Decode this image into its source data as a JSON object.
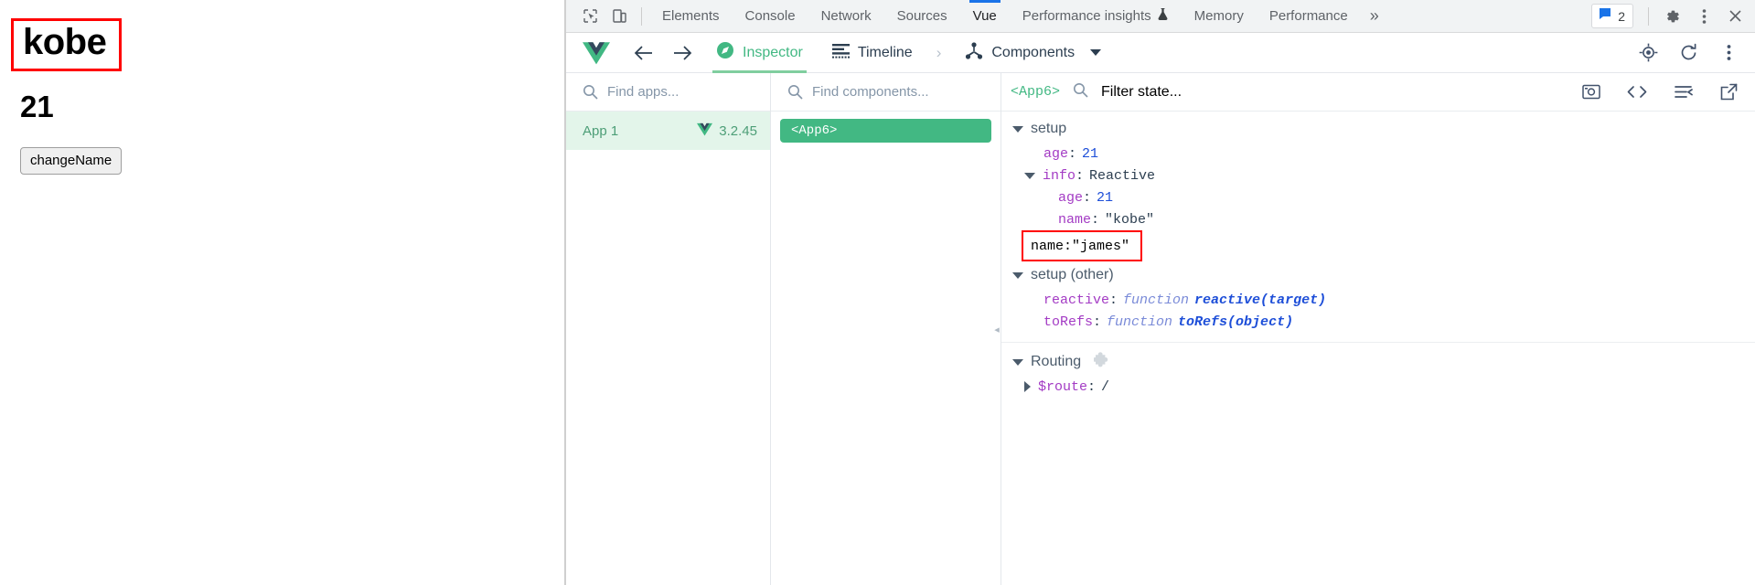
{
  "page": {
    "name": "kobe",
    "age": "21",
    "button_label": "changeName",
    "highlight_color": "#ff0000"
  },
  "devtools": {
    "tabs": [
      {
        "label": "Elements",
        "active": false
      },
      {
        "label": "Console",
        "active": false
      },
      {
        "label": "Network",
        "active": false
      },
      {
        "label": "Sources",
        "active": false
      },
      {
        "label": "Vue",
        "active": true
      },
      {
        "label": "Performance insights",
        "active": false,
        "icon": "beaker-icon"
      },
      {
        "label": "Memory",
        "active": false
      },
      {
        "label": "Performance",
        "active": false
      }
    ],
    "more_tabs_label": "»",
    "issues_count": "2",
    "icons": {
      "inspect": "inspect-element-icon",
      "device": "device-toolbar-icon",
      "issues": "issues-message-icon",
      "settings": "gear-icon",
      "more": "kebab-menu-icon",
      "close": "close-icon"
    },
    "accent": "#1a73e8"
  },
  "vue_toolbar": {
    "logo": "vue-logo-icon",
    "back": "back-arrow-icon",
    "forward": "forward-arrow-icon",
    "items": [
      {
        "label": "Inspector",
        "icon": "compass-icon",
        "active": true
      },
      {
        "label": "Timeline",
        "icon": "timeline-icon",
        "active": false
      },
      {
        "label": "Components",
        "icon": "components-tree-icon",
        "active": false,
        "has_dropdown": true
      }
    ],
    "separator": "›",
    "right_icons": [
      "target-icon",
      "refresh-icon",
      "kebab-menu-icon"
    ],
    "accent": "#42b883"
  },
  "apps_pane": {
    "search_placeholder": "Find apps...",
    "search_icon": "search-icon",
    "items": [
      {
        "name": "App 1",
        "version": "3.2.45",
        "icon": "vue-logo-icon",
        "selected": true
      }
    ]
  },
  "components_pane": {
    "search_placeholder": "Find components...",
    "search_icon": "search-icon",
    "items": [
      {
        "label": "<App6>",
        "selected": true
      }
    ],
    "collapse_handle": "◂"
  },
  "state_pane": {
    "component_tag": "<App6>",
    "filter_placeholder": "Filter state...",
    "filter_icon": "search-icon",
    "header_icons": [
      "screenshot-icon",
      "open-in-editor-code-icon",
      "collapse-all-icon",
      "open-external-icon"
    ],
    "groups": [
      {
        "name": "setup",
        "expanded": true,
        "rows": [
          {
            "indent": 1,
            "key": "age",
            "value": "21",
            "type": "number"
          },
          {
            "indent": 1,
            "key": "info",
            "value": "Reactive",
            "type": "plain",
            "expandable": true,
            "expanded": true
          },
          {
            "indent": 2,
            "key": "age",
            "value": "21",
            "type": "number"
          },
          {
            "indent": 2,
            "key": "name",
            "value": "\"kobe\"",
            "type": "string"
          },
          {
            "indent": 1,
            "key": "name",
            "value": "\"james\"",
            "type": "string",
            "highlighted": true
          }
        ]
      },
      {
        "name": "setup (other)",
        "expanded": true,
        "rows": [
          {
            "indent": 1,
            "key": "reactive",
            "fn_keyword": "function",
            "fn_name": "reactive(target)",
            "type": "function"
          },
          {
            "indent": 1,
            "key": "toRefs",
            "fn_keyword": "function",
            "fn_name": "toRefs(object)",
            "type": "function"
          }
        ]
      },
      {
        "name": "Routing",
        "expanded": true,
        "badge_icon": "puzzle-piece-icon",
        "rows": [
          {
            "indent": 1,
            "key": "$route",
            "value": "/",
            "type": "route",
            "expandable": true,
            "expanded": false
          }
        ]
      }
    ]
  }
}
